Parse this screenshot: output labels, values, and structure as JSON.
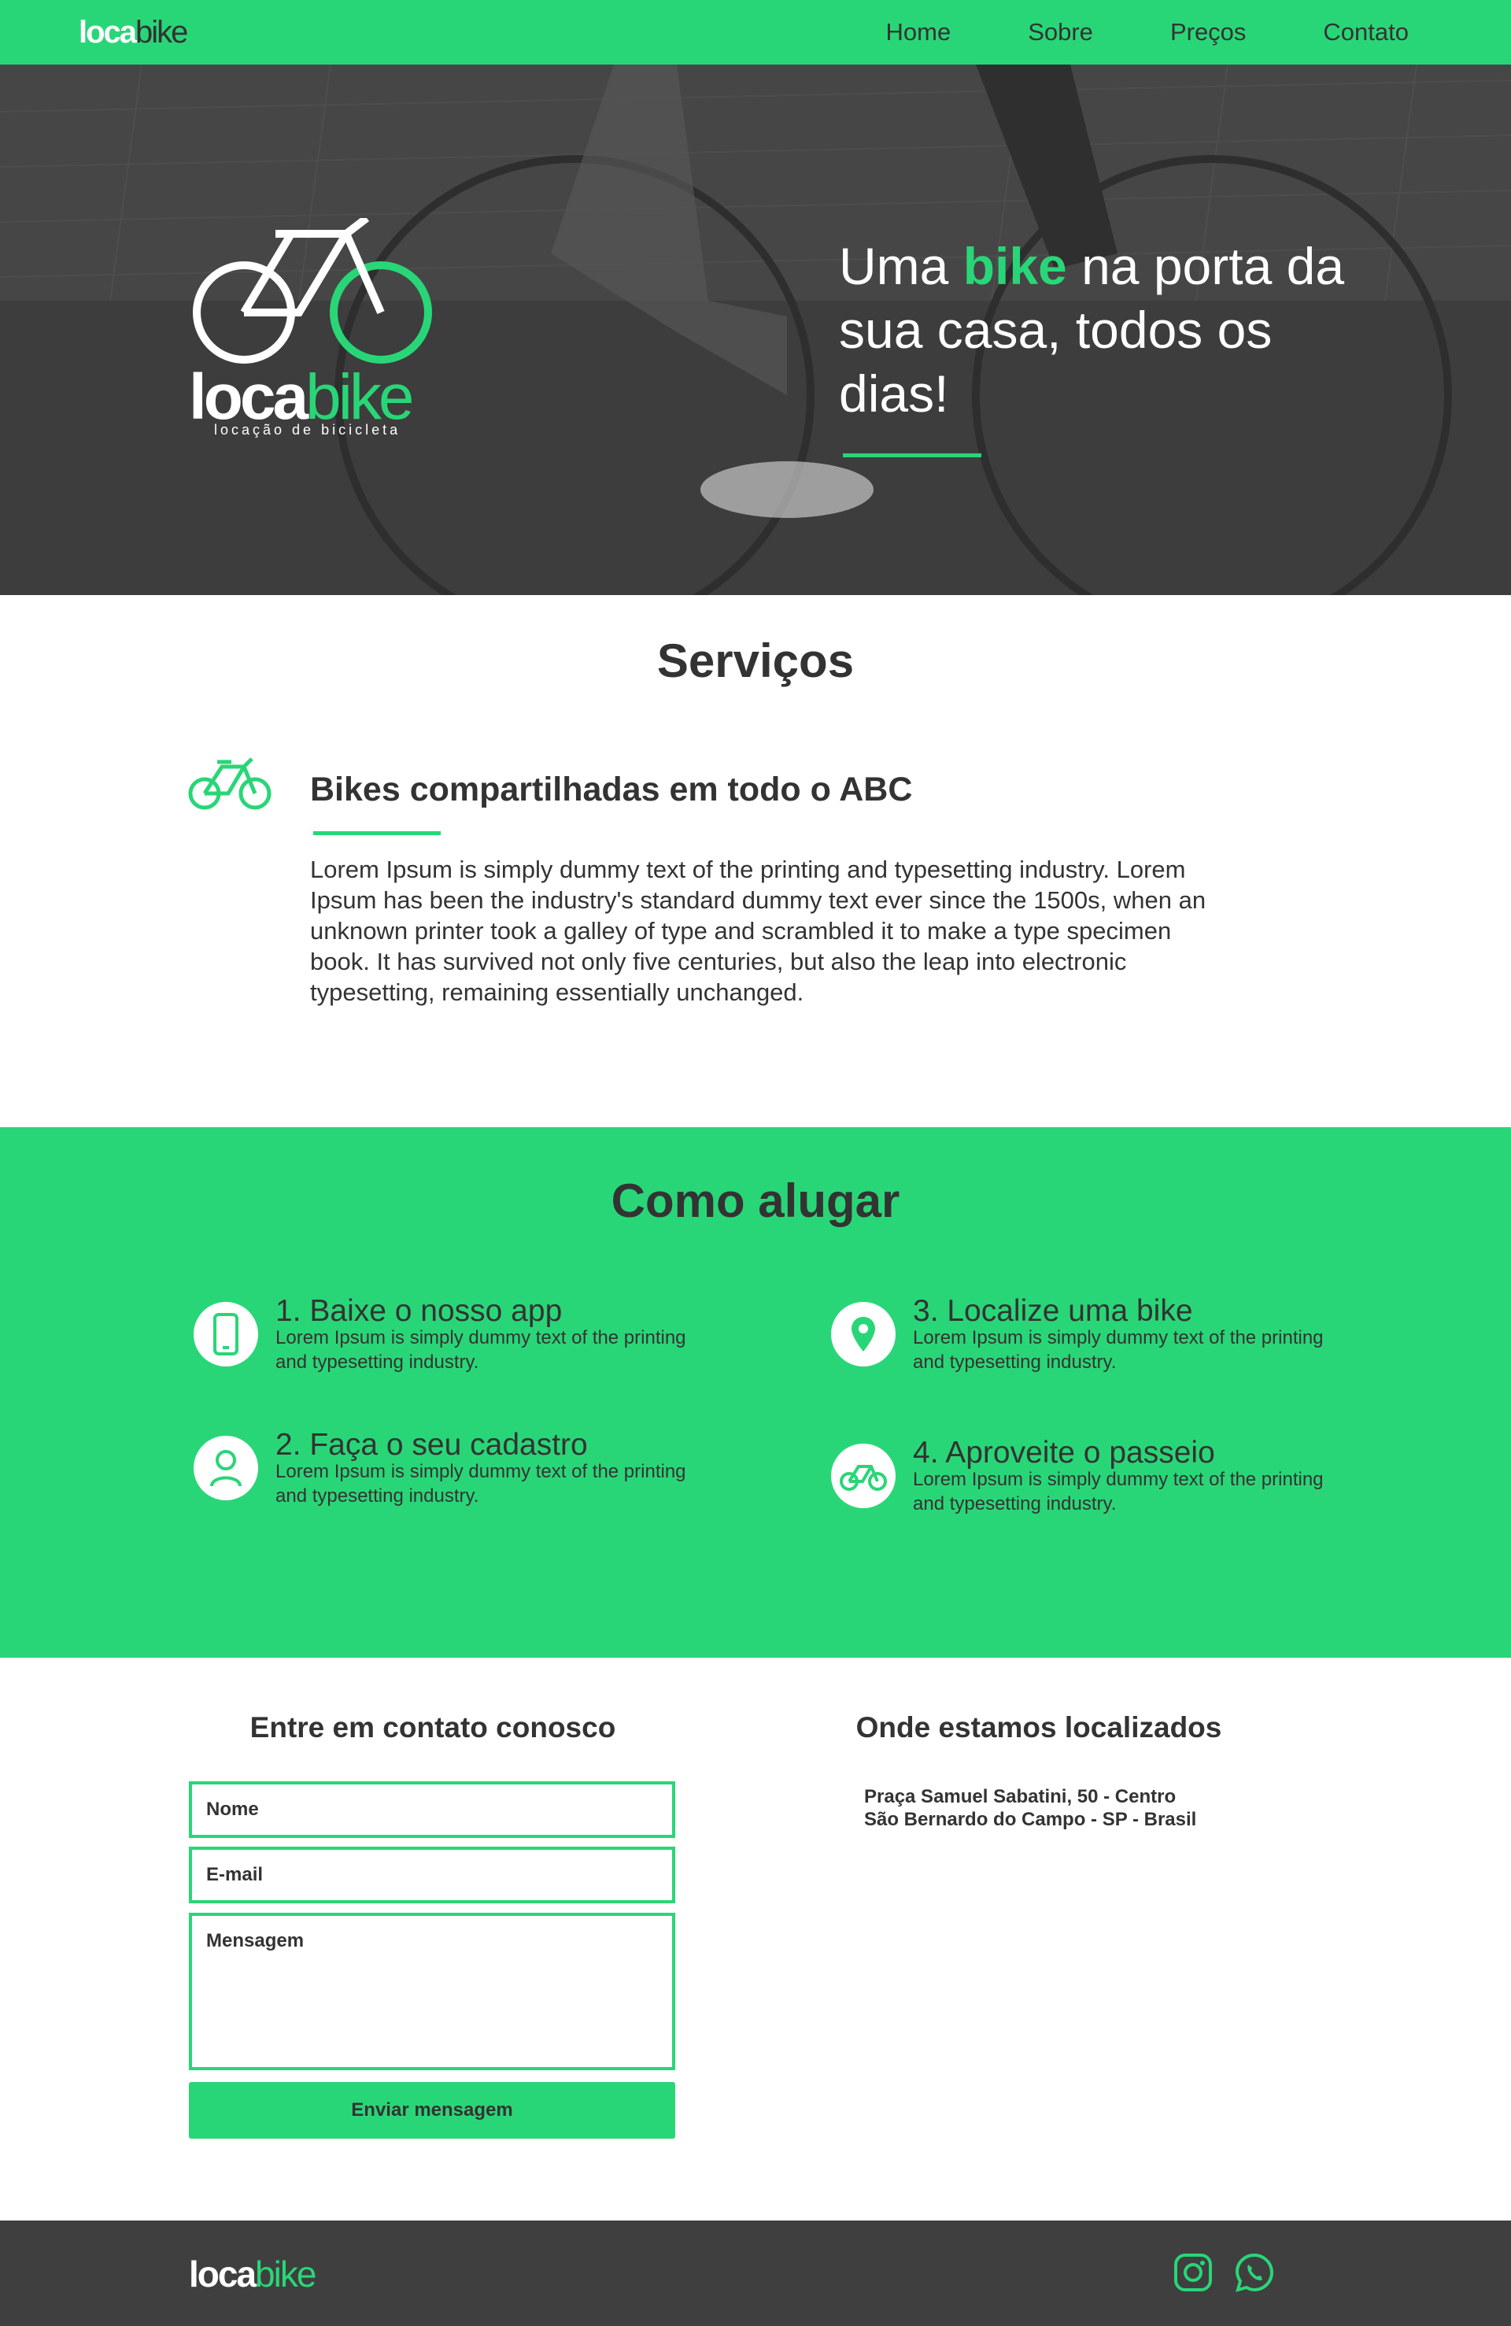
{
  "brand": {
    "bold": "loca",
    "light": "bike",
    "tagline": "locação de bicicleta"
  },
  "nav": {
    "items": [
      "Home",
      "Sobre",
      "Preços",
      "Contato"
    ]
  },
  "hero": {
    "headline_pre": "Uma ",
    "headline_accent": "bike",
    "headline_post": " na porta da sua casa, todos os dias!"
  },
  "services": {
    "title": "Serviços",
    "heading": "Bikes compartilhadas em todo o ABC",
    "text": "Lorem Ipsum is simply dummy text of the printing and typesetting industry. Lorem Ipsum has been the industry's standard dummy text ever since the 1500s, when an unknown printer took a galley of type and scrambled it to make a type specimen book. It has survived not only five centuries, but also the leap into electronic typesetting, remaining essentially unchanged."
  },
  "rent": {
    "title": "Como alugar",
    "steps": [
      {
        "title": "1. Baixe o nosso app",
        "desc": "Lorem Ipsum is simply dummy text of the printing and typesetting industry.",
        "icon": "smartphone-icon"
      },
      {
        "title": "2. Faça o seu cadastro",
        "desc": "Lorem Ipsum is simply dummy text of the printing and typesetting industry.",
        "icon": "user-icon"
      },
      {
        "title": "3. Localize uma bike",
        "desc": "Lorem Ipsum is simply dummy text of the printing and typesetting industry.",
        "icon": "map-pin-icon"
      },
      {
        "title": "4. Aproveite o passeio",
        "desc": "Lorem Ipsum is simply dummy text of the printing and typesetting industry.",
        "icon": "bicycle-icon"
      }
    ]
  },
  "contact": {
    "title": "Entre em contato conosco",
    "name_placeholder": "Nome",
    "email_placeholder": "E-mail",
    "message_placeholder": "Mensagem",
    "submit_label": "Enviar mensagem"
  },
  "location": {
    "title": "Onde estamos localizados",
    "line1": "Praça Samuel Sabatini, 50 - Centro",
    "line2": "São Bernardo do Campo - SP - Brasil"
  },
  "footer": {
    "social": [
      "instagram-icon",
      "whatsapp-icon"
    ]
  },
  "colors": {
    "accent": "#29d677",
    "dark": "#3f3f3f",
    "text": "#333333"
  }
}
